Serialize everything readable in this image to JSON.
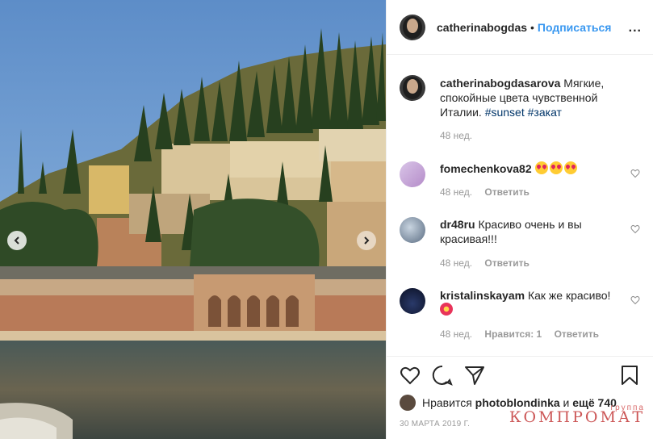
{
  "post": {
    "username": "catherinabogdas",
    "separator": "•",
    "follow_label": "Подписаться",
    "more_label": "..."
  },
  "caption": {
    "username": "catherinabogdasarova",
    "text": "Мягкие, спокойные цвета чувственной Италии.",
    "hashtags": [
      "#sunset",
      "#закат"
    ],
    "age": "48 нед."
  },
  "comments": [
    {
      "username": "fomechenkova82",
      "text": "",
      "emoji": [
        "heart-eyes-emoji",
        "heart-eyes-emoji",
        "heart-eyes-emoji"
      ],
      "age": "48 нед.",
      "reply_label": "Ответить"
    },
    {
      "username": "dr48ru",
      "text": "Красиво очень и вы красивая!!!",
      "age": "48 нед.",
      "reply_label": "Ответить"
    },
    {
      "username": "kristalinskayam",
      "text": "Как же красиво!",
      "emoji": [
        "hibiscus-emoji"
      ],
      "age": "48 нед.",
      "likes_label": "Нравится: 1",
      "reply_label": "Ответить"
    }
  ],
  "likes": {
    "prefix": "Нравится",
    "user": "photoblondinka",
    "connector": "и",
    "others": "ещё 740"
  },
  "date": "30 МАРТА 2019 Г.",
  "watermark": {
    "small": "группа",
    "big": "КОМПРОМАТ"
  },
  "colors": {
    "link": "#3897f0",
    "hashtag": "#003569",
    "meta": "#999999",
    "watermark": "#c43a3a"
  },
  "carousel": {
    "prev_icon": "chevron-left-icon",
    "next_icon": "chevron-right-icon"
  }
}
